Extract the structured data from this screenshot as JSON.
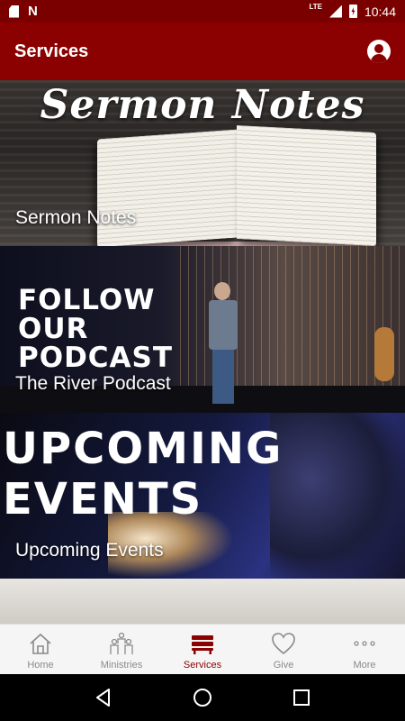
{
  "status_bar": {
    "time": "10:44",
    "network": "LTE",
    "left_icons": [
      "sd-card-icon",
      "n-notification-icon"
    ],
    "notification_letter": "N"
  },
  "app_bar": {
    "title": "Services",
    "profile_icon": "account-circle-icon"
  },
  "cards": [
    {
      "image_text": "Sermon Notes",
      "label": "Sermon Notes"
    },
    {
      "image_text": "FOLLOW OUR PODCAST",
      "label": "The River Podcast"
    },
    {
      "image_text": "UPCOMING EVENTS",
      "label": "Upcoming Events"
    }
  ],
  "bottom_nav": {
    "active": "Services",
    "accent_color": "#8b0000",
    "items": [
      {
        "label": "Home",
        "icon": "home-icon"
      },
      {
        "label": "Ministries",
        "icon": "people-icon"
      },
      {
        "label": "Services",
        "icon": "pews-icon"
      },
      {
        "label": "Give",
        "icon": "heart-icon"
      },
      {
        "label": "More",
        "icon": "more-dots-icon"
      }
    ]
  },
  "system_nav": [
    "back-icon",
    "home-circle-icon",
    "recents-icon"
  ]
}
